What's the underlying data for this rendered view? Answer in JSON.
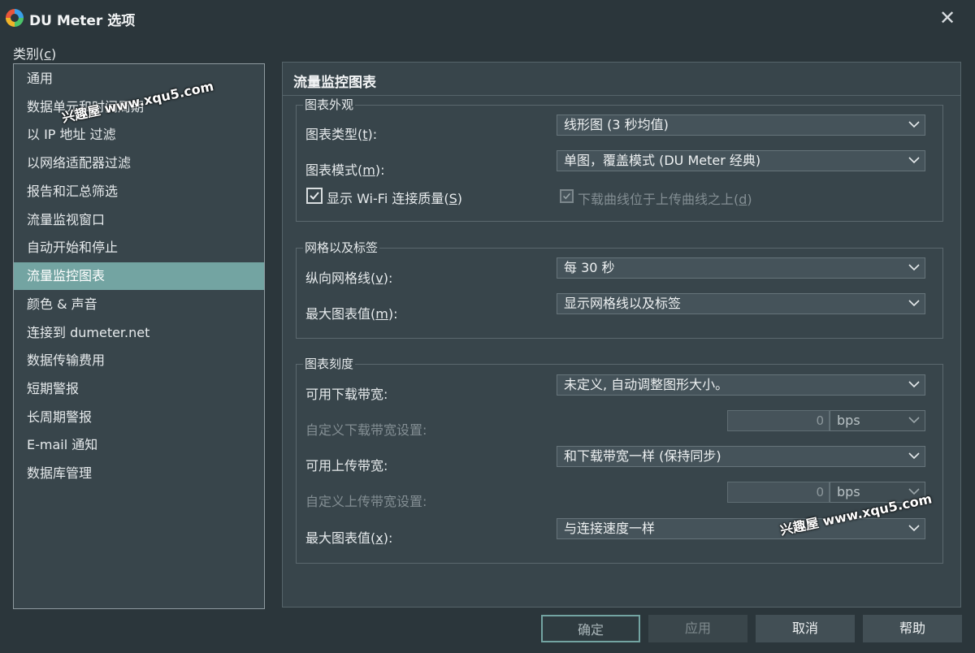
{
  "window": {
    "title": "DU Meter 选项"
  },
  "category_label": {
    "text": "类别(",
    "key": "c",
    "close": ")"
  },
  "sidebar": {
    "items": [
      "通用",
      "数据单元和时间周期",
      "以 IP 地址 过滤",
      "以网络适配器过滤",
      "报告和汇总筛选",
      "流量监视窗口",
      "自动开始和停止",
      "流量监控图表",
      "颜色 & 声音",
      "连接到 dumeter.net",
      "数据传输费用",
      "短期警报",
      "长周期警报",
      "E-mail 通知",
      "数据库管理"
    ],
    "selected_index": 7
  },
  "panel": {
    "title": "流量监控图表",
    "appearance": {
      "title": "图表外观",
      "chart_type": {
        "label": "图表类型(",
        "key": "t",
        "close": "):",
        "value": "线形图 (3 秒均值)"
      },
      "chart_mode": {
        "label": "图表模式(",
        "key": "m",
        "close": "):",
        "value": "单图，覆盖模式 (DU Meter 经典)"
      },
      "wifi_quality": {
        "label": "显示 Wi-Fi 连接质量(",
        "key": "S",
        "close": ")",
        "checked": true
      },
      "download_above": {
        "label": "下载曲线位于上传曲线之上(",
        "key": "d",
        "close": ")",
        "checked": true,
        "disabled": true
      }
    },
    "grid": {
      "title": "网格以及标签",
      "vertical_grid": {
        "label": "纵向网格线(",
        "key": "v",
        "close": "):",
        "value": "每 30 秒"
      },
      "max_value": {
        "label": "最大图表值(",
        "key": "m",
        "close": "):",
        "value": "显示网格线以及标签"
      }
    },
    "scale": {
      "title": "图表刻度",
      "download_bw": {
        "label": "可用下载带宽:",
        "value": "未定义, 自动调整图形大小。"
      },
      "custom_download": {
        "label": "自定义下载带宽设置:",
        "value": "0",
        "unit": "bps"
      },
      "upload_bw": {
        "label": "可用上传带宽:",
        "value": "和下载带宽一样 (保持同步)"
      },
      "custom_upload": {
        "label": "自定义上传带宽设置:",
        "value": "0",
        "unit": "bps"
      },
      "max_value": {
        "label": "最大图表值(",
        "key": "x",
        "close": "):",
        "value": "与连接速度一样"
      }
    }
  },
  "buttons": {
    "ok": "确定",
    "apply": "应用",
    "cancel": "取消",
    "help": "帮助"
  },
  "watermarks": [
    "兴趣屋 www.xqu5.com",
    "兴趣屋 www.xqu5.com"
  ],
  "colors": {
    "accent": "#73a4a2",
    "background": "#2b363b",
    "panel": "#38454b"
  }
}
